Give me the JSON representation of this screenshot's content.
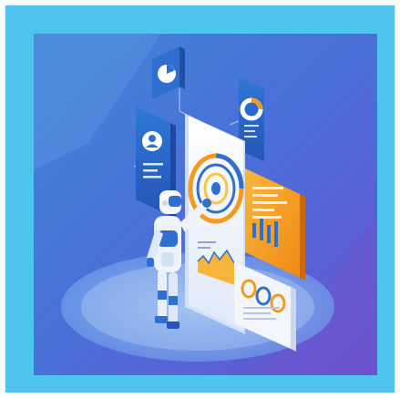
{
  "image": {
    "subject": "isometric-robot-analytics-dashboard",
    "colors": {
      "frame": "#4fc4ec",
      "background_top": "#3e7fd6",
      "background_bottom": "#6a54cf",
      "accent_orange": "#f59a1e",
      "accent_yellow": "#f7c644",
      "panel_blue": "#2f6fd0",
      "panel_light": "#eef3fb"
    }
  }
}
